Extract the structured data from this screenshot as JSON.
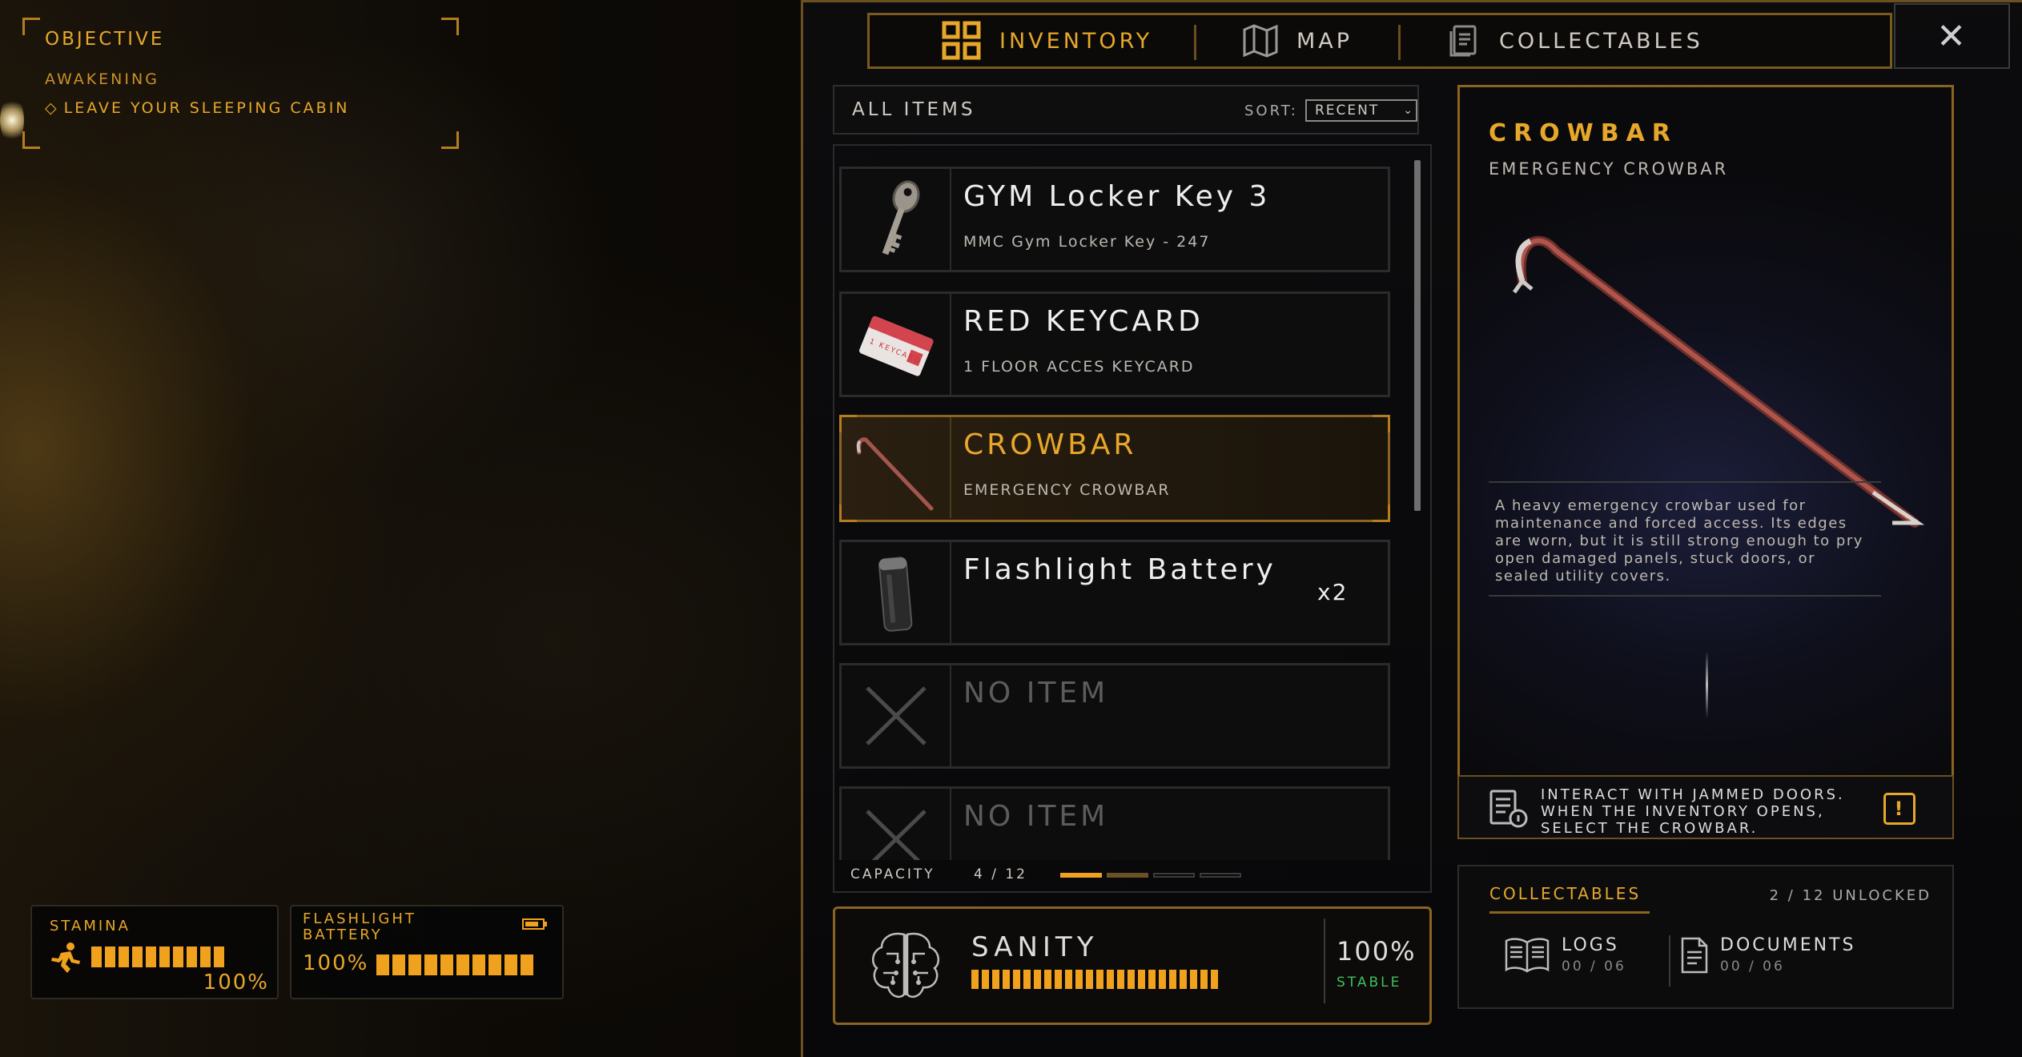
{
  "objective": {
    "heading": "OBJECTIVE",
    "chapter": "AWAKENING",
    "task": "LEAVE YOUR SLEEPING CABIN",
    "task_marker": "◇"
  },
  "tabs": {
    "inventory": "INVENTORY",
    "map": "MAP",
    "collectables": "COLLECTABLES",
    "close": "✕"
  },
  "list": {
    "filter_label": "ALL ITEMS",
    "sort_label": "SORT:",
    "sort_value": "RECENT",
    "items": [
      {
        "name": "GYM Locker Key 3",
        "sub": "MMC Gym Locker Key - 247",
        "icon": "key-icon"
      },
      {
        "name": "RED KEYCARD",
        "sub": "1 FLOOR ACCES KEYCARD",
        "icon": "keycard-icon",
        "card_text": "1 KEYCARD"
      },
      {
        "name": "CROWBAR",
        "sub": "EMERGENCY CROWBAR",
        "icon": "crowbar-icon"
      },
      {
        "name": "Flashlight Battery",
        "sub": "",
        "qty": "x2",
        "icon": "battery-icon"
      },
      {
        "name": "NO ITEM",
        "sub": "",
        "icon": "empty-slot-icon"
      },
      {
        "name": "NO ITEM",
        "sub": "",
        "icon": "empty-slot-icon"
      }
    ],
    "capacity_label": "CAPACITY",
    "capacity_value": "4 / 12",
    "capacity_pages": 4,
    "capacity_active_page": 1
  },
  "sanity": {
    "label": "SANITY",
    "percent": "100%",
    "status": "STABLE",
    "level": 1.0
  },
  "detail": {
    "title": "CROWBAR",
    "subtitle": "EMERGENCY CROWBAR",
    "description": "A heavy emergency crowbar used for maintenance and forced access. Its edges are worn, but it is still strong enough to pry open damaged panels, stuck doors, or sealed utility covers.",
    "hint": "INTERACT WITH JAMMED DOORS. WHEN THE INVENTORY OPENS, SELECT THE CROWBAR.",
    "hint_badge": "!"
  },
  "collectables": {
    "heading": "COLLECTABLES",
    "unlocked": "2 / 12  UNLOCKED",
    "logs_label": "LOGS",
    "logs_value": "00 / 06",
    "documents_label": "DOCUMENTS",
    "documents_value": "00 / 06"
  },
  "hud": {
    "stamina_label": "STAMINA",
    "stamina_value": "100%",
    "stamina_level": 1.0,
    "battery_label_1": "FLASHLIGHT",
    "battery_label_2": "BATTERY",
    "battery_value": "100%",
    "battery_level": 1.0
  },
  "colors": {
    "accent": "#e7a72a",
    "bar": "#f0a21e",
    "stable": "#3fbf5a"
  }
}
